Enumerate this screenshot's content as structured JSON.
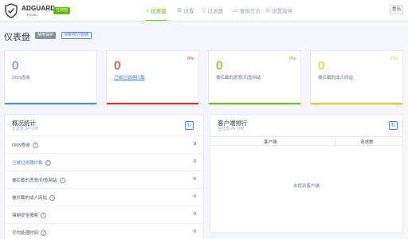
{
  "header": {
    "brand": "ADGUARD",
    "brand_sub": "HOME",
    "status": "已启用",
    "nav": [
      {
        "icon": "⌂",
        "label": "仪表盘"
      },
      {
        "icon": "⚙",
        "label": "设置"
      },
      {
        "icon": "▽",
        "label": "过滤器"
      },
      {
        "icon": "▭",
        "label": "查询日志"
      },
      {
        "icon": "◎",
        "label": "设置指导"
      }
    ],
    "logout": "登出"
  },
  "page": {
    "title": "仪表盘",
    "disable_btn": "禁用保护",
    "refresh_btn": "刷新统计数据"
  },
  "stats": [
    {
      "value": "0",
      "pct": "",
      "label": "DNS查询",
      "color": "#467fcf"
    },
    {
      "value": "0",
      "pct": "0%",
      "label": "已被过滤器拦截",
      "color": "#cd201f"
    },
    {
      "value": "0",
      "pct": "0%",
      "label": "被拦截的恶意/钓鱼网站",
      "color": "#5eba00"
    },
    {
      "value": "0",
      "pct": "0%",
      "label": "被拦截的成人网站",
      "color": "#f1c40f"
    }
  ],
  "overview": {
    "title": "概况统计",
    "subtitle": "在过去 24 小时",
    "rows": [
      {
        "label": "DNS查询",
        "value": "0"
      },
      {
        "label": "已被过滤器拦截",
        "value": "0"
      },
      {
        "label": "被拦截的恶意/钓鱼网站",
        "value": "0"
      },
      {
        "label": "被拦截的成人网站",
        "value": "0"
      },
      {
        "label": "强制安全搜索",
        "value": "0"
      },
      {
        "label": "平均处理时间",
        "value": "0"
      }
    ]
  },
  "clients": {
    "title": "客户端排行",
    "subtitle": "在过去 24 小时",
    "col_client": "客户端",
    "col_requests": "请求数",
    "empty": "未找到客户端"
  }
}
